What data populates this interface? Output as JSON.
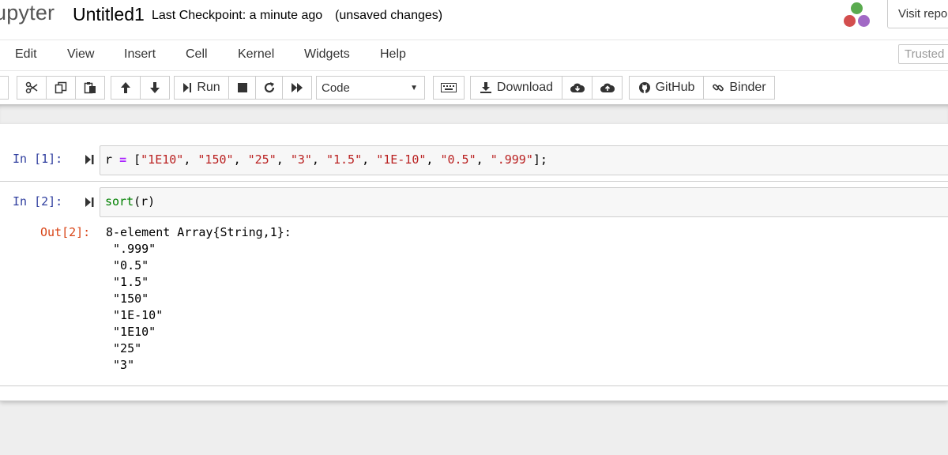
{
  "header": {
    "logo_text": "upyter",
    "notebook_name": "Untitled1",
    "checkpoint": "Last Checkpoint: a minute ago",
    "unsaved": "(unsaved changes)",
    "visit_button": "Visit repo"
  },
  "menubar": {
    "items": [
      "Edit",
      "View",
      "Insert",
      "Cell",
      "Kernel",
      "Widgets",
      "Help"
    ],
    "trusted": "Trusted"
  },
  "toolbar": {
    "run_label": "Run",
    "cell_type": "Code",
    "download_label": "Download",
    "github_label": "GitHub",
    "binder_label": "Binder"
  },
  "cells": [
    {
      "prompt": "In [1]:",
      "tokens": [
        {
          "t": "r",
          "c": "var"
        },
        {
          "t": " ",
          "c": "var"
        },
        {
          "t": "=",
          "c": "op"
        },
        {
          "t": " [",
          "c": "var"
        },
        {
          "t": "\"1E10\"",
          "c": "str"
        },
        {
          "t": ", ",
          "c": "var"
        },
        {
          "t": "\"150\"",
          "c": "str"
        },
        {
          "t": ", ",
          "c": "var"
        },
        {
          "t": "\"25\"",
          "c": "str"
        },
        {
          "t": ", ",
          "c": "var"
        },
        {
          "t": "\"3\"",
          "c": "str"
        },
        {
          "t": ", ",
          "c": "var"
        },
        {
          "t": "\"1.5\"",
          "c": "str"
        },
        {
          "t": ", ",
          "c": "var"
        },
        {
          "t": "\"1E-10\"",
          "c": "str"
        },
        {
          "t": ", ",
          "c": "var"
        },
        {
          "t": "\"0.5\"",
          "c": "str"
        },
        {
          "t": ", ",
          "c": "var"
        },
        {
          "t": "\".999\"",
          "c": "str"
        },
        {
          "t": "];",
          "c": "var"
        }
      ]
    },
    {
      "prompt": "In [2]:",
      "tokens": [
        {
          "t": "sort",
          "c": "fn"
        },
        {
          "t": "(r)",
          "c": "var"
        }
      ],
      "out_prompt": "Out[2]:",
      "output": [
        "8-element Array{String,1}:",
        " \".999\"",
        " \"0.5\"",
        " \"1.5\"",
        " \"150\"",
        " \"1E-10\"",
        " \"1E10\"",
        " \"25\"",
        " \"3\""
      ]
    }
  ]
}
